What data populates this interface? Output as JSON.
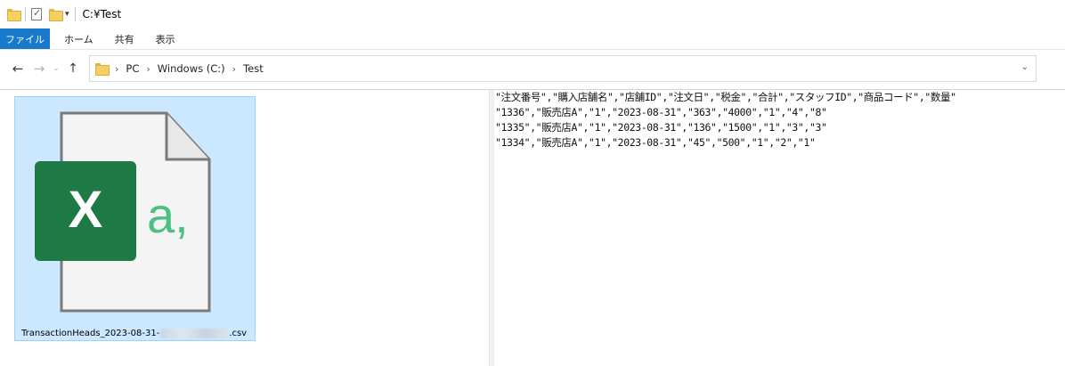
{
  "window": {
    "title": "C:¥Test"
  },
  "ribbon": {
    "tabs": [
      {
        "label": "ファイル"
      },
      {
        "label": "ホーム"
      },
      {
        "label": "共有"
      },
      {
        "label": "表示"
      }
    ]
  },
  "address": {
    "crumbs": [
      "PC",
      "Windows (C:)",
      "Test"
    ]
  },
  "file_tile": {
    "name_prefix": "TransactionHeads_2023-08-31-",
    "name_suffix": ".csv",
    "icon_text": "a,",
    "badge_letter": "X",
    "badge_color": "#1d7a45",
    "accent_color": "#4cbf82"
  },
  "preview": {
    "lines": [
      "\"注文番号\",\"購入店舗名\",\"店舗ID\",\"注文日\",\"税金\",\"合計\",\"スタッフID\",\"商品コード\",\"数量\"",
      "\"1336\",\"販売店A\",\"1\",\"2023-08-31\",\"363\",\"4000\",\"1\",\"4\",\"8\"",
      "\"1335\",\"販売店A\",\"1\",\"2023-08-31\",\"136\",\"1500\",\"1\",\"3\",\"3\"",
      "\"1334\",\"販売店A\",\"1\",\"2023-08-31\",\"45\",\"500\",\"1\",\"2\",\"1\""
    ]
  }
}
